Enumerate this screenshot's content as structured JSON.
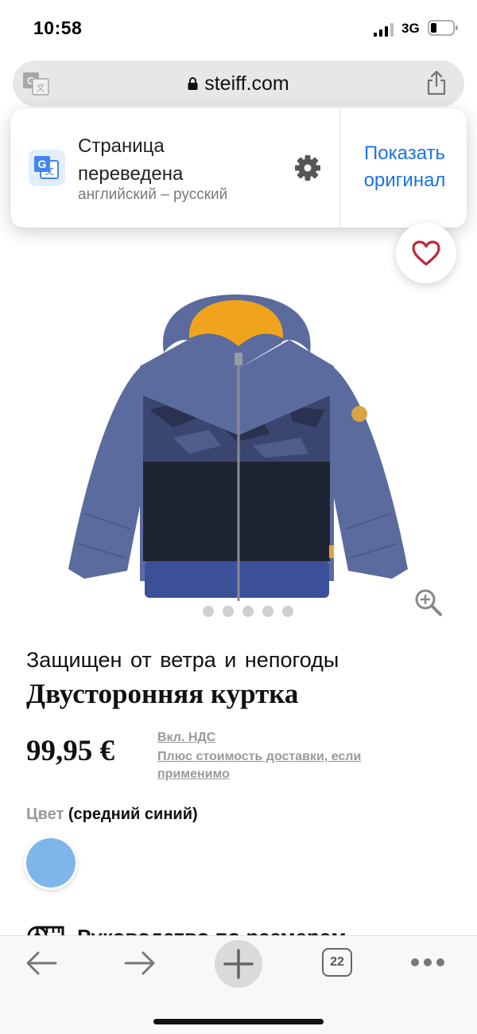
{
  "status_bar": {
    "time": "10:58",
    "network": "3G"
  },
  "browser": {
    "url": "steiff.com",
    "translate_popup": {
      "title": "Страница переведена",
      "subtitle": "английский – русский",
      "show_original": "Показать оригинал"
    },
    "tab_count": "22"
  },
  "product": {
    "subtitle": "Защищен от ветра и непогоды",
    "title": "Двусторонняя куртка",
    "price": "99,95 €",
    "vat_note": "Вкл. НДС",
    "shipping_note": "Плюс стоимость доставки, если применимо",
    "color_label": "Цвет",
    "color_value": "(средний синий)",
    "swatch_color": "#7eb6ea",
    "image_slide_count": 5,
    "size_guide": "Руководство по размерам"
  },
  "colors": {
    "link_blue": "#1a73e8",
    "favorite_red": "#c0283c"
  },
  "icons": [
    "signal-icon",
    "battery-icon",
    "translate-icon",
    "lock-icon",
    "share-icon",
    "gear-icon",
    "heart-icon",
    "zoom-icon",
    "ruler-icon",
    "back-arrow-icon",
    "forward-arrow-icon",
    "plus-icon",
    "more-icon"
  ]
}
